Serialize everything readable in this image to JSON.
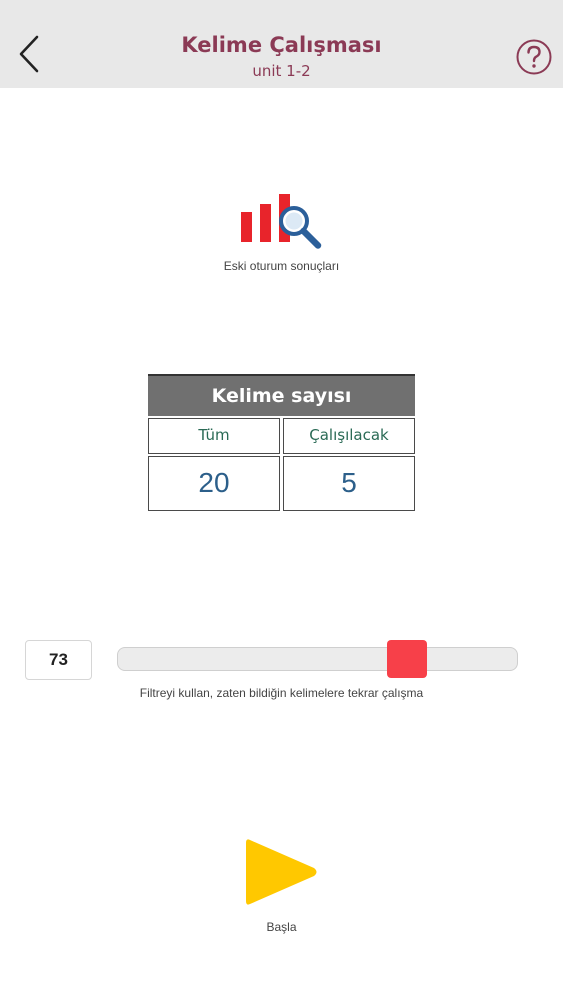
{
  "header": {
    "title": "Kelime Çalışması",
    "subtitle": "unit 1-2",
    "back_icon": "chevron-left-icon",
    "help_icon": "question-circle-icon"
  },
  "session_results": {
    "icon": "bar-chart-search-icon",
    "label": "Eski oturum sonuçları"
  },
  "word_count": {
    "header": "Kelime sayısı",
    "columns": [
      {
        "label": "Tüm",
        "value": "20"
      },
      {
        "label": "Çalışılacak",
        "value": "5"
      }
    ]
  },
  "filter": {
    "value": "73",
    "slider_level": 0.73,
    "hint": "Filtreyi kullan, zaten bildiğin kelimelere tekrar çalışma"
  },
  "start": {
    "icon": "play-icon",
    "label": "Başla"
  },
  "colors": {
    "title": "#8b3a55",
    "header_bg": "#e8e8e8",
    "accent_red": "#f74049",
    "play_yellow": "#ffc800",
    "value_blue": "#2c5f8a",
    "column_green": "#2a6a55"
  }
}
